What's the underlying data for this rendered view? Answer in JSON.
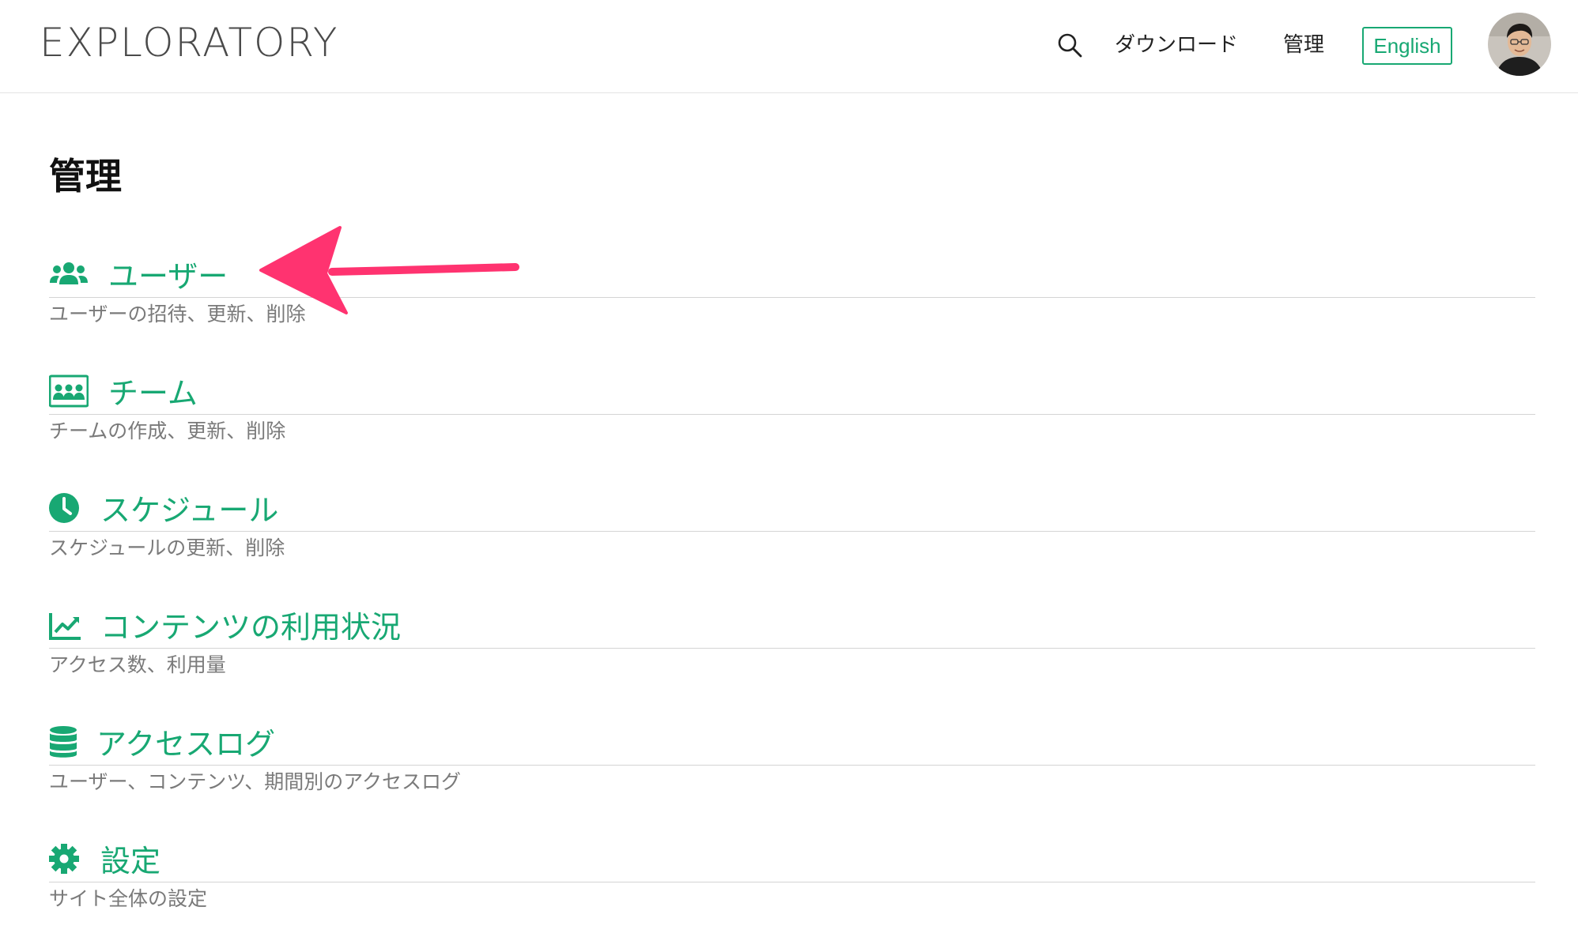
{
  "header": {
    "logo": "EXPLORATORY",
    "nav": {
      "download": "ダウンロード",
      "admin": "管理",
      "language": "English"
    }
  },
  "page": {
    "title": "管理"
  },
  "sections": [
    {
      "title": "ユーザー",
      "description": "ユーザーの招待、更新、削除",
      "icon": "users-icon"
    },
    {
      "title": "チーム",
      "description": "チームの作成、更新、削除",
      "icon": "team-icon"
    },
    {
      "title": "スケジュール",
      "description": "スケジュールの更新、削除",
      "icon": "clock-icon"
    },
    {
      "title": "コンテンツの利用状況",
      "description": "アクセス数、利用量",
      "icon": "chart-icon"
    },
    {
      "title": "アクセスログ",
      "description": "ユーザー、コンテンツ、期間別のアクセスログ",
      "icon": "database-icon"
    },
    {
      "title": "設定",
      "description": "サイト全体の設定",
      "icon": "gear-icon"
    }
  ],
  "colors": {
    "accent": "#18a873",
    "annotation_arrow": "#ff3370"
  }
}
